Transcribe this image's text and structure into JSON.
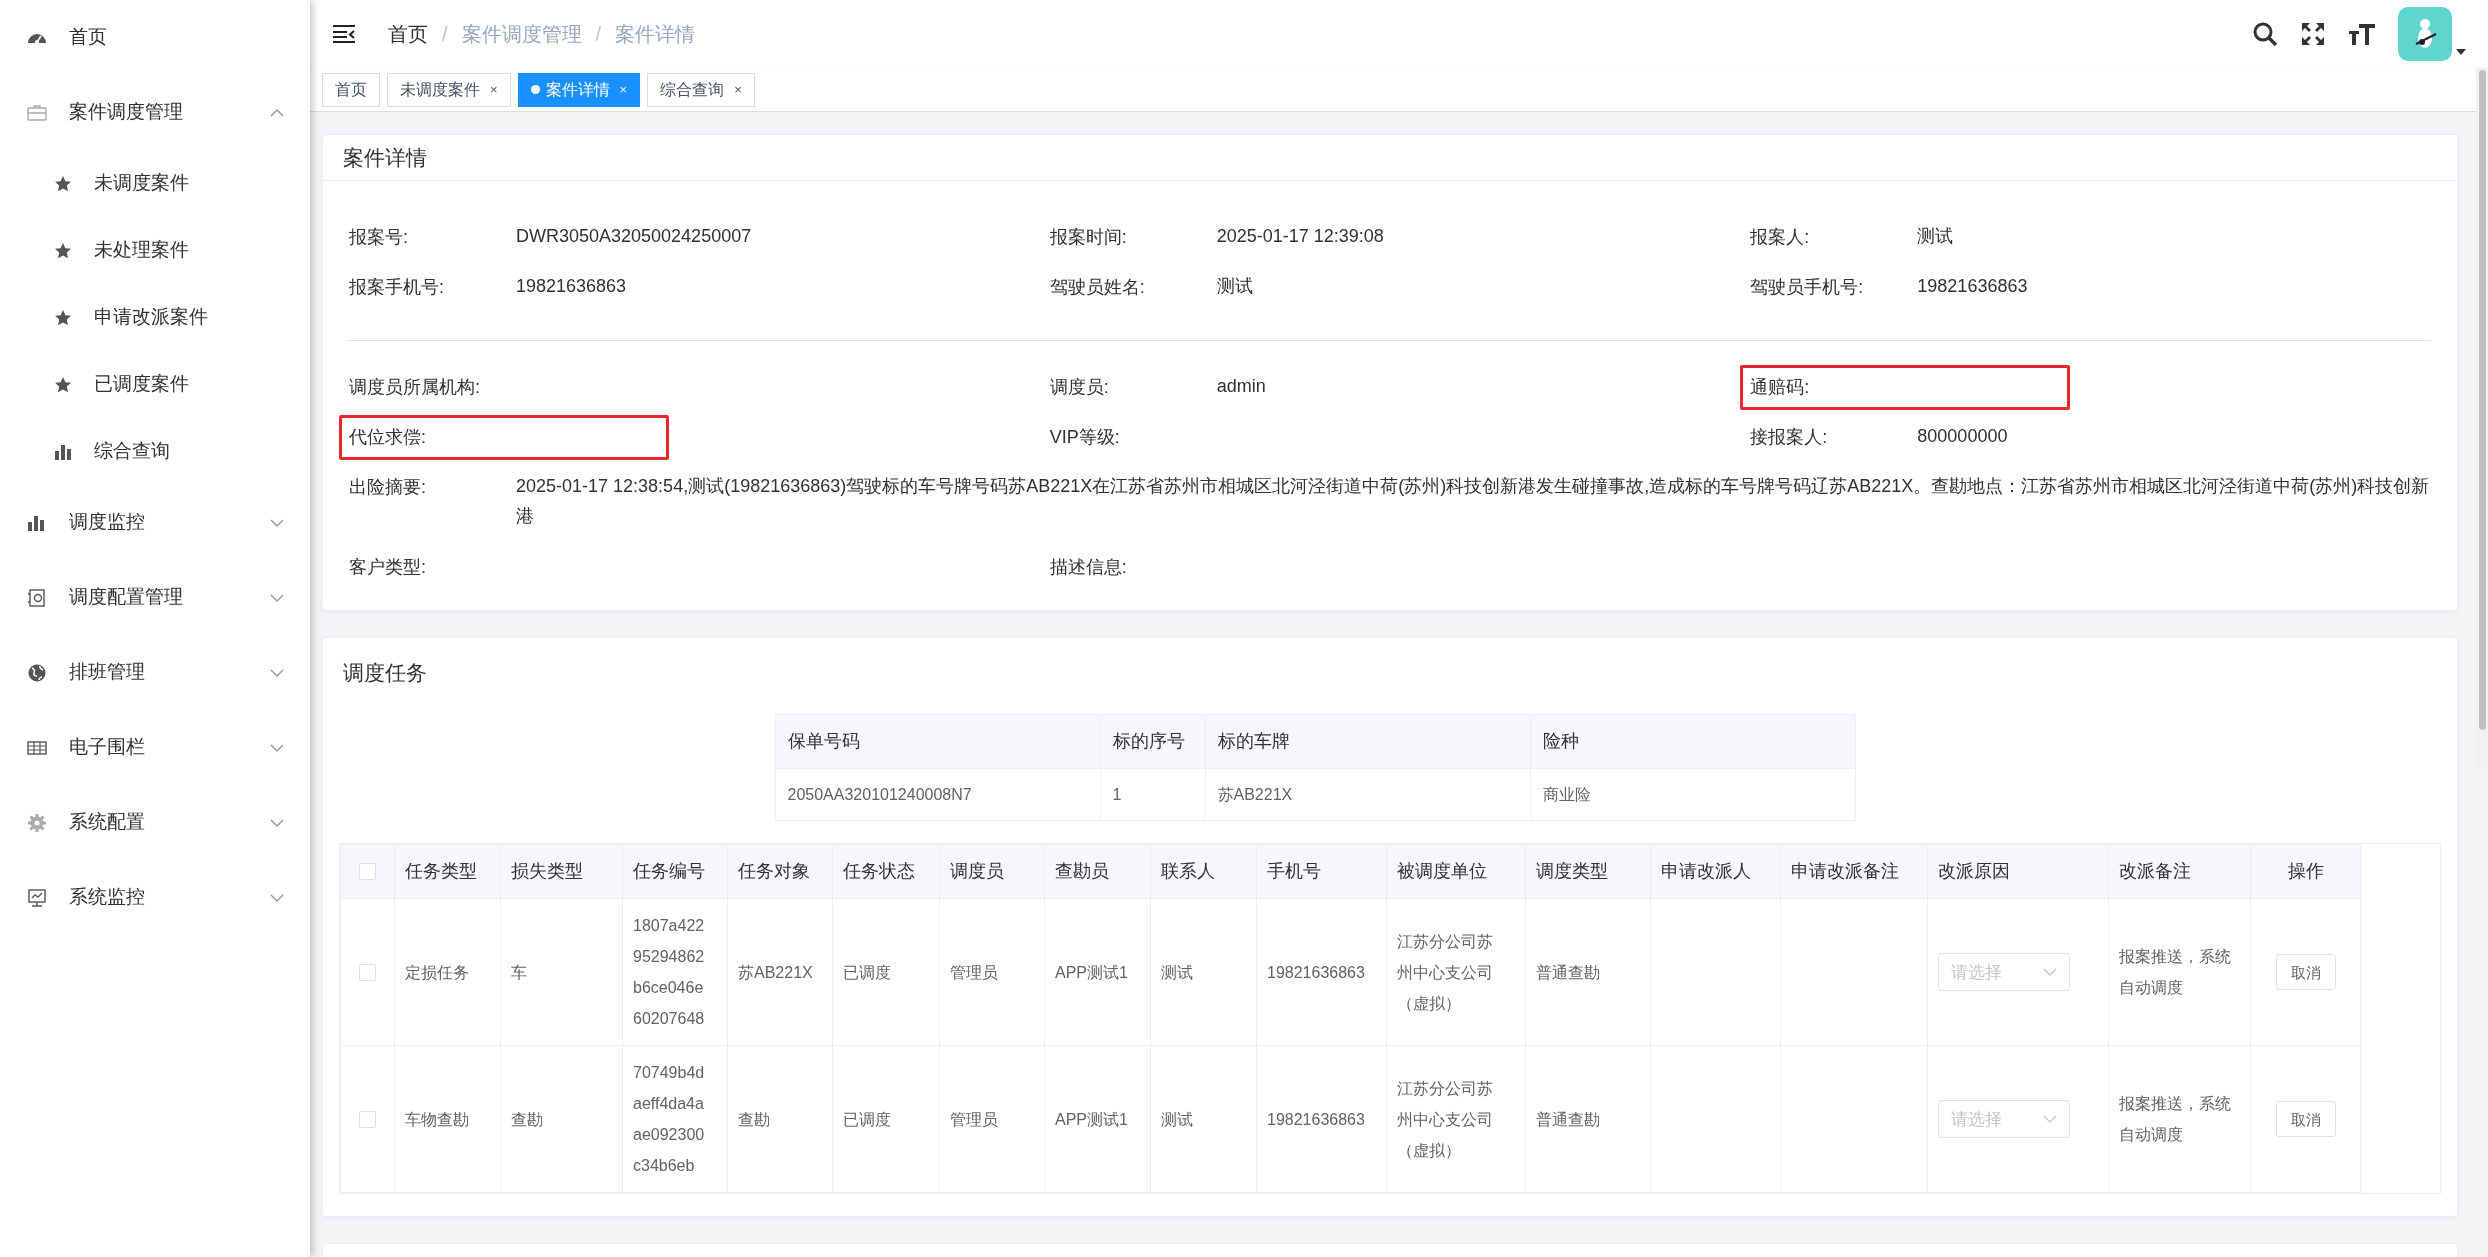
{
  "sidebar": {
    "items": [
      {
        "label": "首页",
        "kind": "link"
      },
      {
        "label": "案件调度管理",
        "kind": "group",
        "expanded": true,
        "children": [
          {
            "label": "未调度案件"
          },
          {
            "label": "未处理案件"
          },
          {
            "label": "申请改派案件"
          },
          {
            "label": "已调度案件"
          },
          {
            "label": "综合查询"
          }
        ]
      },
      {
        "label": "调度监控",
        "kind": "group",
        "expanded": false
      },
      {
        "label": "调度配置管理",
        "kind": "group",
        "expanded": false
      },
      {
        "label": "排班管理",
        "kind": "group",
        "expanded": false
      },
      {
        "label": "电子围栏",
        "kind": "group",
        "expanded": false
      },
      {
        "label": "系统配置",
        "kind": "group",
        "expanded": false
      },
      {
        "label": "系统监控",
        "kind": "group",
        "expanded": false
      }
    ]
  },
  "breadcrumb": {
    "separator": "/",
    "items": [
      "首页",
      "案件调度管理",
      "案件详情"
    ]
  },
  "tabs": [
    {
      "label": "首页",
      "selected": false
    },
    {
      "label": "未调度案件",
      "selected": false,
      "close": "×"
    },
    {
      "label": "案件详情",
      "selected": true,
      "close": "×"
    },
    {
      "label": "综合查询",
      "selected": false,
      "close": "×"
    }
  ],
  "case_detail": {
    "title": "案件详情",
    "groups": [
      [
        {
          "label": "报案号:",
          "value": "DWR3050A32050024250007",
          "highlighted": false
        },
        {
          "label": "报案时间:",
          "value": "2025-01-17 12:39:08",
          "highlighted": false
        },
        {
          "label": "报案人:",
          "value": "测试",
          "highlighted": false
        },
        {
          "label": "报案手机号:",
          "value": "19821636863",
          "highlighted": false
        },
        {
          "label": "驾驶员姓名:",
          "value": "测试",
          "highlighted": false
        },
        {
          "label": "驾驶员手机号:",
          "value": "19821636863",
          "highlighted": false
        }
      ],
      [
        {
          "label": "调度员所属机构:",
          "highlighted": false
        },
        {
          "label": "调度员:",
          "value": "admin",
          "highlighted": false
        },
        {
          "label": "通赔码:",
          "highlighted": true
        },
        {
          "label": "代位求偿:",
          "highlighted": true
        },
        {
          "label": "VIP等级:",
          "highlighted": false
        },
        {
          "label": "接报案人:",
          "value": "800000000",
          "highlighted": false
        },
        {
          "label": "出险摘要:",
          "value": "2025-01-17 12:38:54,测试(19821636863)驾驶标的车号牌号码苏AB221X在江苏省苏州市相城区北河泾街道中荷(苏州)科技创新港发生碰撞事故,造成标的车号牌号码辽苏AB221X。查勘地点：江苏省苏州市相城区北河泾街道中荷(苏州)科技创新港",
          "highlighted": false,
          "wide": true
        },
        {
          "label": "客户类型:",
          "highlighted": false
        },
        {
          "label": "描述信息:",
          "highlighted": false
        }
      ]
    ]
  },
  "dispatch_tasks": {
    "title": "调度任务",
    "policy_table": {
      "columns": [
        "保单号码",
        "标的序号",
        "标的车牌",
        "险种"
      ],
      "rows": [
        [
          "2050AA320101240008N7",
          "1",
          "苏AB221X",
          "商业险"
        ]
      ]
    },
    "task_table": {
      "header_checked": false,
      "columns": [
        "任务类型",
        "损失类型",
        "任务编号",
        "任务对象",
        "任务状态",
        "调度员",
        "查勘员",
        "联系人",
        "手机号",
        "被调度单位",
        "调度类型",
        "申请改派人",
        "申请改派备注",
        "改派原因",
        "改派备注",
        "操作"
      ],
      "rows": [
        {
          "checked": false,
          "task_type": "定损任务",
          "loss_type": "车",
          "task_no": "1807a42295294862b6ce046e60207648",
          "target": "苏AB221X",
          "status": "已调度",
          "dispatcher": "管理员",
          "surveyor": "APP测试1",
          "contact": "测试",
          "phone": "19821636863",
          "unit": "江苏分公司苏州中心支公司（虚拟）",
          "dispatch_type": "普通查勘",
          "reason_placeholder": "请选择",
          "reason_note": "报案推送，系统自动调度",
          "action": "取消"
        },
        {
          "checked": false,
          "task_type": "车物查勘",
          "loss_type": "查勘",
          "task_no": "70749b4daeff4da4aae092300c34b6eb",
          "target": "查勘",
          "status": "已调度",
          "dispatcher": "管理员",
          "surveyor": "APP测试1",
          "contact": "测试",
          "phone": "19821636863",
          "unit": "江苏分公司苏州中心支公司（虚拟）",
          "dispatch_type": "普通查勘",
          "reason_placeholder": "请选择",
          "reason_note": "报案推送，系统自动调度",
          "action": "取消"
        }
      ]
    }
  }
}
